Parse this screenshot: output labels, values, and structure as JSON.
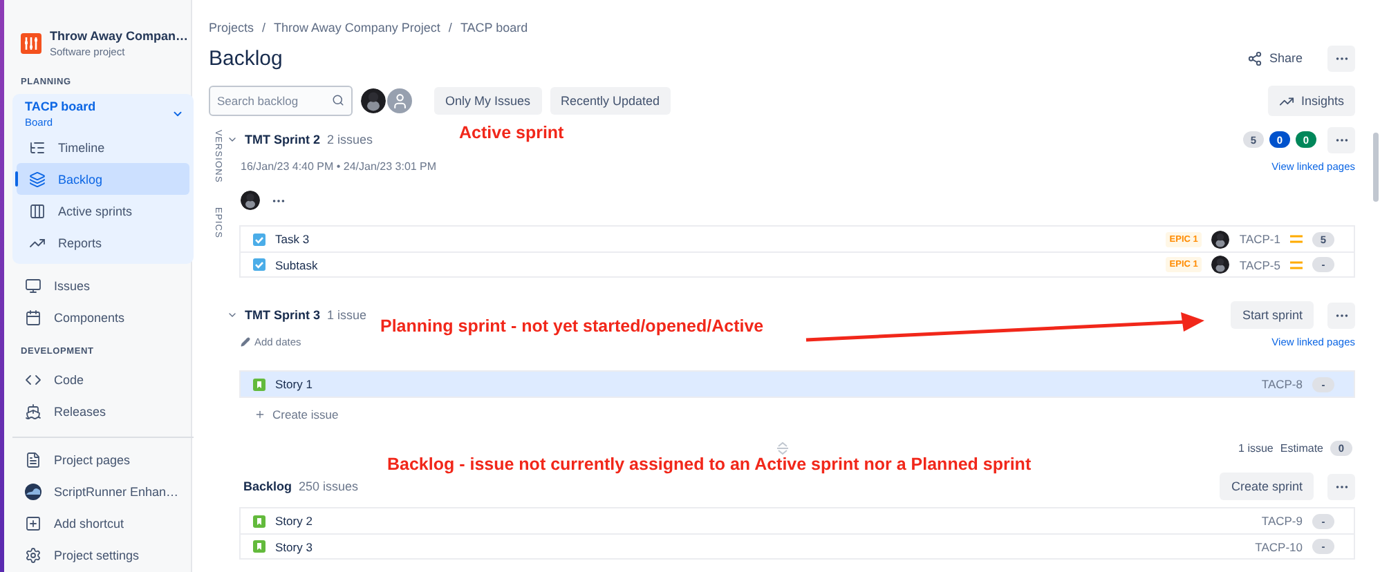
{
  "sidebar": {
    "project": {
      "name": "Throw Away Compan…",
      "type": "Software project"
    },
    "planning": {
      "heading": "PLANNING",
      "board": {
        "name": "TACP board",
        "subtitle": "Board",
        "expanded": true,
        "items": [
          {
            "label": "Timeline",
            "selected": false
          },
          {
            "label": "Backlog",
            "selected": true
          },
          {
            "label": "Active sprints",
            "selected": false
          },
          {
            "label": "Reports",
            "selected": false
          }
        ]
      },
      "items": [
        {
          "label": "Issues",
          "selected": false
        },
        {
          "label": "Components",
          "selected": false
        }
      ]
    },
    "development": {
      "heading": "DEVELOPMENT",
      "items": [
        {
          "label": "Code",
          "selected": false
        },
        {
          "label": "Releases",
          "selected": false
        }
      ]
    },
    "footer_items": [
      {
        "label": "Project pages",
        "selected": false
      },
      {
        "label": "ScriptRunner Enhan…",
        "selected": false
      },
      {
        "label": "Add shortcut",
        "selected": false
      },
      {
        "label": "Project settings",
        "selected": false
      }
    ]
  },
  "breadcrumbs": [
    "Projects",
    "Throw Away Company Project",
    "TACP board"
  ],
  "breadcrumb_separator": "/",
  "title": "Backlog",
  "share": "Share",
  "toolbar": {
    "search": {
      "placeholder": "Search backlog"
    },
    "avatars": [
      {
        "kind": "photo"
      },
      {
        "kind": "default"
      }
    ],
    "filters": [
      "Only My Issues",
      "Recently Updated"
    ],
    "insights": "Insights"
  },
  "side_tabs": [
    "VERSIONS",
    "EPICS"
  ],
  "sprints": [
    {
      "kind": "active",
      "name": "TMT Sprint 2",
      "count": "2 issues",
      "expanded": true,
      "dates": "16/Jan/23 4:40 PM • 24/Jan/23 3:01 PM",
      "status_counts": [
        {
          "value": "5",
          "color": "#dfe1e6"
        },
        {
          "value": "0",
          "color": "#0052cc"
        },
        {
          "value": "0",
          "color": "#00875a"
        }
      ],
      "link": "View linked pages",
      "assignees": [
        {
          "kind": "photo"
        }
      ],
      "issues": [
        {
          "kind": "task",
          "summary": "Task 3",
          "epic": "EPIC 1",
          "assigned": true,
          "key": "TACP-1",
          "prioritized": true,
          "estimate": "5",
          "selected": false
        },
        {
          "kind": "task",
          "summary": "Subtask",
          "epic": "EPIC 1",
          "assigned": true,
          "key": "TACP-5",
          "prioritized": true,
          "estimate": "-",
          "selected": false
        }
      ]
    },
    {
      "kind": "planned",
      "name": "TMT Sprint 3",
      "count": "1 issue",
      "expanded": true,
      "add_dates": "Add dates",
      "action": "Start sprint",
      "link": "View linked pages",
      "issues": [
        {
          "kind": "story",
          "summary": "Story 1",
          "key": "TACP-8",
          "estimate": "-",
          "selected": true
        }
      ],
      "create_issue": "Create issue",
      "summary": {
        "issues": "1 issue",
        "estimate_label": "Estimate",
        "estimate": "0"
      }
    },
    {
      "kind": "backlog",
      "name": "Backlog",
      "count": "250 issues",
      "action": "Create sprint",
      "issues": [
        {
          "kind": "story",
          "summary": "Story 2",
          "key": "TACP-9",
          "estimate": "-",
          "selected": false
        },
        {
          "kind": "story",
          "summary": "Story 3",
          "key": "TACP-10",
          "estimate": "-",
          "selected": false
        }
      ]
    }
  ],
  "annotations": [
    {
      "text": "Active sprint"
    },
    {
      "text": "Planning sprint - not yet started/opened/Active",
      "arrow": true
    },
    {
      "text": "Backlog - issue not currently assigned to an Active sprint nor a Planned sprint"
    }
  ]
}
